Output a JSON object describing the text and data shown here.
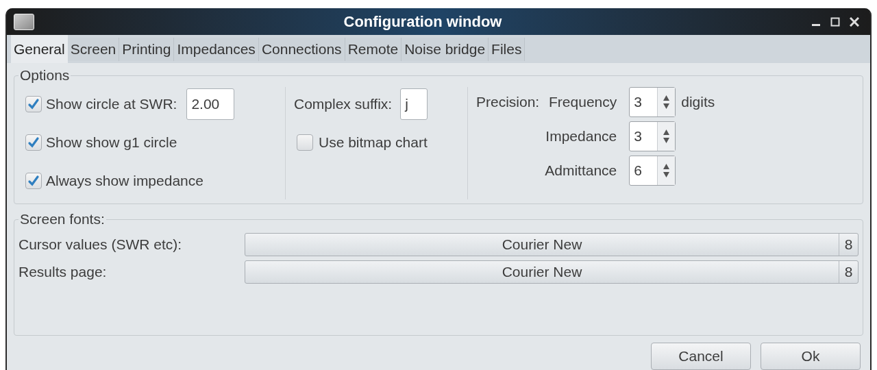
{
  "window": {
    "title": "Configuration window"
  },
  "tabs": [
    {
      "label": "General",
      "selected": true
    },
    {
      "label": "Screen",
      "selected": false
    },
    {
      "label": "Printing",
      "selected": false
    },
    {
      "label": "Impedances",
      "selected": false
    },
    {
      "label": "Connections",
      "selected": false
    },
    {
      "label": "Remote",
      "selected": false
    },
    {
      "label": "Noise bridge",
      "selected": false
    },
    {
      "label": "Files",
      "selected": false
    }
  ],
  "options": {
    "title": "Options",
    "checks": [
      {
        "label": "Show circle at SWR:",
        "checked": true,
        "value": "2.00"
      },
      {
        "label": "Show show g1 circle",
        "checked": true
      },
      {
        "label": "Always show impedance",
        "checked": true
      }
    ],
    "complex_suffix": {
      "label": "Complex suffix:",
      "value": "j"
    },
    "bitmap": {
      "label": "Use bitmap chart",
      "checked": false
    },
    "precision": {
      "label": "Precision:",
      "suffix": "digits",
      "rows": [
        {
          "label": "Frequency",
          "value": "3"
        },
        {
          "label": "Impedance",
          "value": "3"
        },
        {
          "label": "Admittance",
          "value": "6"
        }
      ]
    }
  },
  "screen_fonts": {
    "title": "Screen fonts:",
    "rows": [
      {
        "label": "Cursor values (SWR etc):",
        "font": "Courier New",
        "size": "8"
      },
      {
        "label": "Results page:",
        "font": "Courier New",
        "size": "8"
      }
    ]
  },
  "buttons": [
    "Cancel",
    "Ok"
  ]
}
